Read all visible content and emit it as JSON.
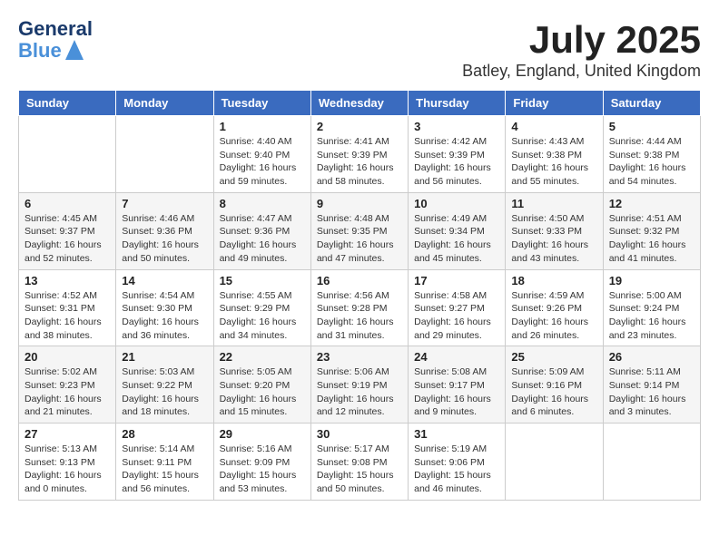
{
  "logo": {
    "line1": "General",
    "line2": "Blue"
  },
  "title": "July 2025",
  "location": "Batley, England, United Kingdom",
  "weekdays": [
    "Sunday",
    "Monday",
    "Tuesday",
    "Wednesday",
    "Thursday",
    "Friday",
    "Saturday"
  ],
  "weeks": [
    [
      {
        "day": "",
        "info": ""
      },
      {
        "day": "",
        "info": ""
      },
      {
        "day": "1",
        "info": "Sunrise: 4:40 AM\nSunset: 9:40 PM\nDaylight: 16 hours\nand 59 minutes."
      },
      {
        "day": "2",
        "info": "Sunrise: 4:41 AM\nSunset: 9:39 PM\nDaylight: 16 hours\nand 58 minutes."
      },
      {
        "day": "3",
        "info": "Sunrise: 4:42 AM\nSunset: 9:39 PM\nDaylight: 16 hours\nand 56 minutes."
      },
      {
        "day": "4",
        "info": "Sunrise: 4:43 AM\nSunset: 9:38 PM\nDaylight: 16 hours\nand 55 minutes."
      },
      {
        "day": "5",
        "info": "Sunrise: 4:44 AM\nSunset: 9:38 PM\nDaylight: 16 hours\nand 54 minutes."
      }
    ],
    [
      {
        "day": "6",
        "info": "Sunrise: 4:45 AM\nSunset: 9:37 PM\nDaylight: 16 hours\nand 52 minutes."
      },
      {
        "day": "7",
        "info": "Sunrise: 4:46 AM\nSunset: 9:36 PM\nDaylight: 16 hours\nand 50 minutes."
      },
      {
        "day": "8",
        "info": "Sunrise: 4:47 AM\nSunset: 9:36 PM\nDaylight: 16 hours\nand 49 minutes."
      },
      {
        "day": "9",
        "info": "Sunrise: 4:48 AM\nSunset: 9:35 PM\nDaylight: 16 hours\nand 47 minutes."
      },
      {
        "day": "10",
        "info": "Sunrise: 4:49 AM\nSunset: 9:34 PM\nDaylight: 16 hours\nand 45 minutes."
      },
      {
        "day": "11",
        "info": "Sunrise: 4:50 AM\nSunset: 9:33 PM\nDaylight: 16 hours\nand 43 minutes."
      },
      {
        "day": "12",
        "info": "Sunrise: 4:51 AM\nSunset: 9:32 PM\nDaylight: 16 hours\nand 41 minutes."
      }
    ],
    [
      {
        "day": "13",
        "info": "Sunrise: 4:52 AM\nSunset: 9:31 PM\nDaylight: 16 hours\nand 38 minutes."
      },
      {
        "day": "14",
        "info": "Sunrise: 4:54 AM\nSunset: 9:30 PM\nDaylight: 16 hours\nand 36 minutes."
      },
      {
        "day": "15",
        "info": "Sunrise: 4:55 AM\nSunset: 9:29 PM\nDaylight: 16 hours\nand 34 minutes."
      },
      {
        "day": "16",
        "info": "Sunrise: 4:56 AM\nSunset: 9:28 PM\nDaylight: 16 hours\nand 31 minutes."
      },
      {
        "day": "17",
        "info": "Sunrise: 4:58 AM\nSunset: 9:27 PM\nDaylight: 16 hours\nand 29 minutes."
      },
      {
        "day": "18",
        "info": "Sunrise: 4:59 AM\nSunset: 9:26 PM\nDaylight: 16 hours\nand 26 minutes."
      },
      {
        "day": "19",
        "info": "Sunrise: 5:00 AM\nSunset: 9:24 PM\nDaylight: 16 hours\nand 23 minutes."
      }
    ],
    [
      {
        "day": "20",
        "info": "Sunrise: 5:02 AM\nSunset: 9:23 PM\nDaylight: 16 hours\nand 21 minutes."
      },
      {
        "day": "21",
        "info": "Sunrise: 5:03 AM\nSunset: 9:22 PM\nDaylight: 16 hours\nand 18 minutes."
      },
      {
        "day": "22",
        "info": "Sunrise: 5:05 AM\nSunset: 9:20 PM\nDaylight: 16 hours\nand 15 minutes."
      },
      {
        "day": "23",
        "info": "Sunrise: 5:06 AM\nSunset: 9:19 PM\nDaylight: 16 hours\nand 12 minutes."
      },
      {
        "day": "24",
        "info": "Sunrise: 5:08 AM\nSunset: 9:17 PM\nDaylight: 16 hours\nand 9 minutes."
      },
      {
        "day": "25",
        "info": "Sunrise: 5:09 AM\nSunset: 9:16 PM\nDaylight: 16 hours\nand 6 minutes."
      },
      {
        "day": "26",
        "info": "Sunrise: 5:11 AM\nSunset: 9:14 PM\nDaylight: 16 hours\nand 3 minutes."
      }
    ],
    [
      {
        "day": "27",
        "info": "Sunrise: 5:13 AM\nSunset: 9:13 PM\nDaylight: 16 hours\nand 0 minutes."
      },
      {
        "day": "28",
        "info": "Sunrise: 5:14 AM\nSunset: 9:11 PM\nDaylight: 15 hours\nand 56 minutes."
      },
      {
        "day": "29",
        "info": "Sunrise: 5:16 AM\nSunset: 9:09 PM\nDaylight: 15 hours\nand 53 minutes."
      },
      {
        "day": "30",
        "info": "Sunrise: 5:17 AM\nSunset: 9:08 PM\nDaylight: 15 hours\nand 50 minutes."
      },
      {
        "day": "31",
        "info": "Sunrise: 5:19 AM\nSunset: 9:06 PM\nDaylight: 15 hours\nand 46 minutes."
      },
      {
        "day": "",
        "info": ""
      },
      {
        "day": "",
        "info": ""
      }
    ]
  ]
}
